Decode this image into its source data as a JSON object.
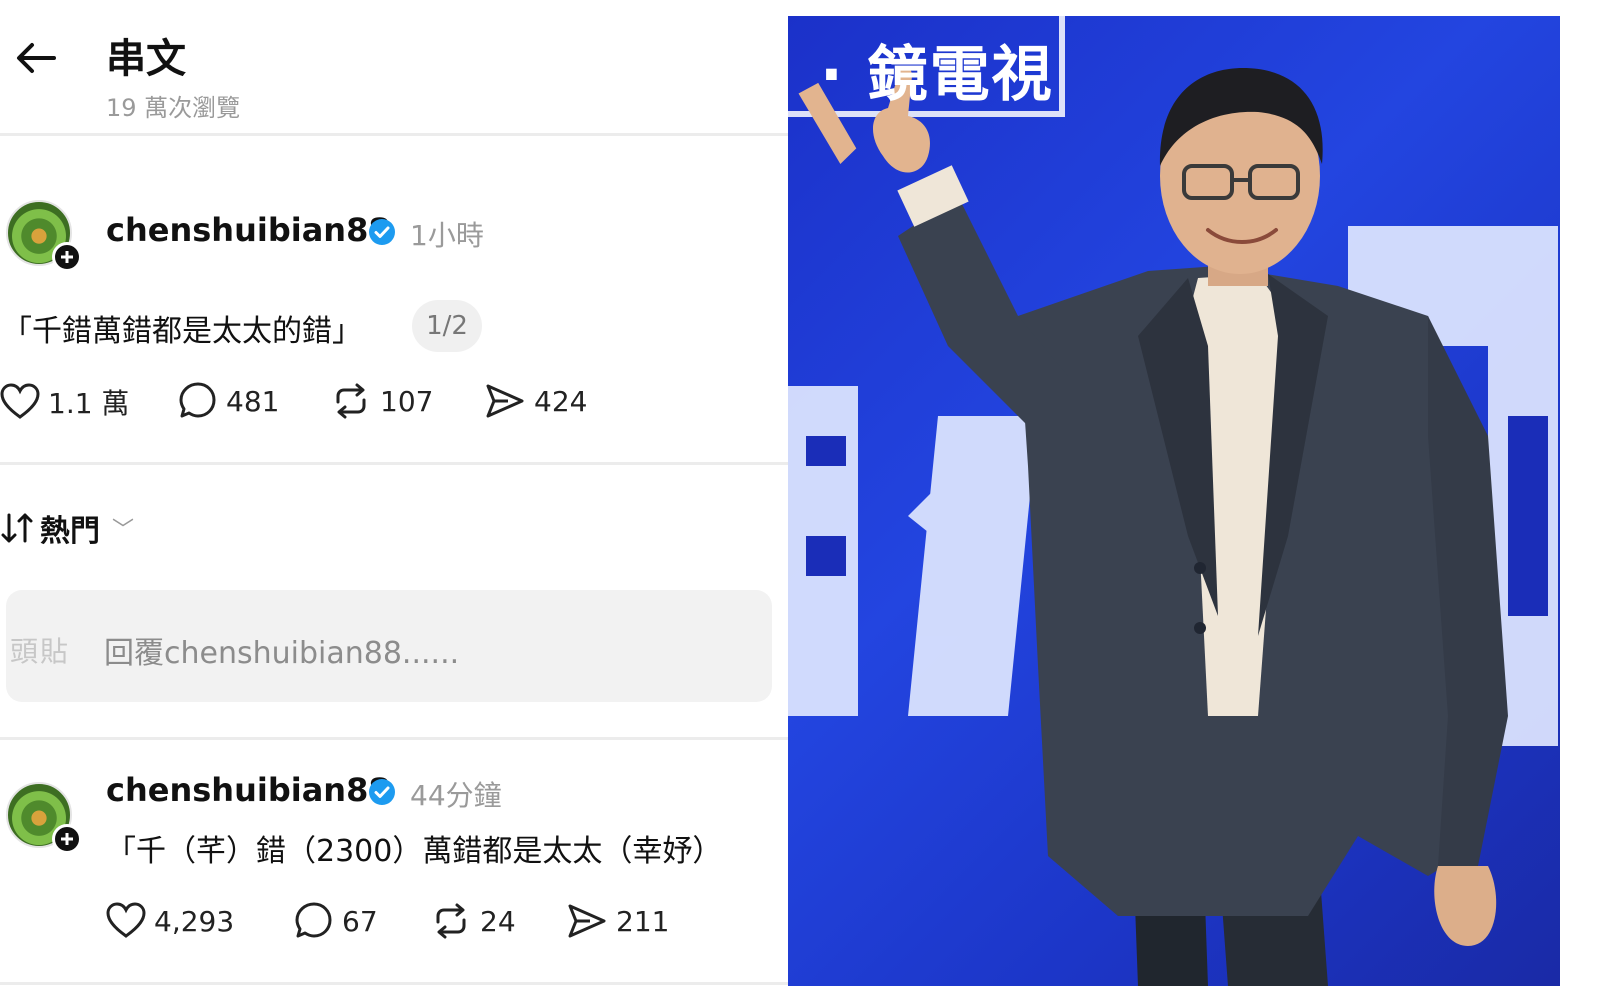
{
  "header": {
    "title": "串文",
    "views": "19 萬次瀏覽"
  },
  "post": {
    "username": "chenshuibian88",
    "time": "1小時",
    "text": "「千錯萬錯都是太太的錯」",
    "page_indicator": "1/2",
    "likes": "1.1 萬",
    "comments": "481",
    "reposts": "107",
    "shares": "424"
  },
  "sort": {
    "label": "熱門"
  },
  "reply": {
    "prefix": "頭貼",
    "placeholder": "回覆chenshuibian88......"
  },
  "reply_post": {
    "username": "chenshuibian88",
    "time": "44分鐘",
    "text": "「千（芊）錯（2300）萬錯都是太太（幸妤）",
    "likes": "4,293",
    "comments": "67",
    "reposts": "24",
    "shares": "211"
  },
  "photo": {
    "brand_text": "· 鏡電視"
  },
  "icons": {
    "back": "arrow-left-icon",
    "verified": "verified-badge-icon",
    "like": "heart-icon",
    "comment": "comment-bubble-icon",
    "repost": "repost-icon",
    "share": "send-icon",
    "sort": "sort-arrows-icon"
  },
  "colors": {
    "verified": "#1d9bf0",
    "photo_bg": "#2345e0",
    "muted": "#9a9a9a"
  }
}
